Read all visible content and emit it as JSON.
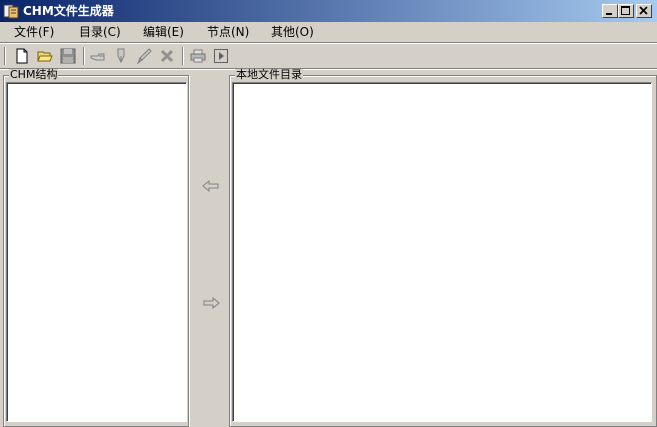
{
  "window": {
    "title": "CHM文件生成器",
    "app_icon": "chm-app-icon"
  },
  "window_controls": [
    "minimize-icon",
    "maximize-icon",
    "close-icon"
  ],
  "menu": [
    {
      "label": "文件(F)"
    },
    {
      "label": "目录(C)"
    },
    {
      "label": "编辑(E)"
    },
    {
      "label": "节点(N)"
    },
    {
      "label": "其他(O)"
    }
  ],
  "toolbar": {
    "icons": [
      "new-file-icon",
      "open-folder-icon",
      "save-icon",
      "pointer-hand-icon",
      "pen-icon",
      "edit-brush-icon",
      "delete-x-icon",
      "print-icon",
      "run-icon"
    ]
  },
  "panels": {
    "left_label": "CHM结构",
    "right_label": "本地文件目录"
  },
  "transfer": {
    "left_arrow": "arrow-left-icon",
    "right_arrow": "arrow-right-icon"
  }
}
